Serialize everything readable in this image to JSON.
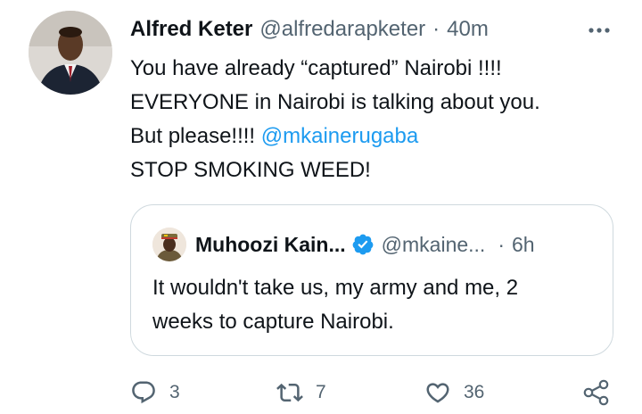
{
  "tweet": {
    "author": {
      "display_name": "Alfred Keter",
      "handle": "@alfredarapketer",
      "avatar_icon": "profile-photo"
    },
    "separator": "·",
    "time": "40m",
    "more_icon": "more-horizontal-icon",
    "text": {
      "line1": "You have already “captured” Nairobi !!!!",
      "line2": "EVERYONE in Nairobi is talking about you.",
      "line3_prefix": "But please!!!! ",
      "mention": "@mkainerugaba",
      "line4": "STOP SMOKING WEED!"
    },
    "quoted": {
      "display_name": "Muhoozi Kain...",
      "verified_icon": "verified-badge-icon",
      "handle": "@mkaine...",
      "separator": "·",
      "time": "6h",
      "text": {
        "line1": "It wouldn't take us, my army and me, 2",
        "line2": "weeks to capture Nairobi."
      }
    },
    "actions": {
      "reply_count": "3",
      "retweet_count": "7",
      "like_count": "36",
      "share_icon": "share-icon"
    }
  },
  "colors": {
    "link": "#1d9bf0",
    "text_primary": "#0f1419",
    "text_secondary": "#536471",
    "border": "#cfd9de"
  }
}
